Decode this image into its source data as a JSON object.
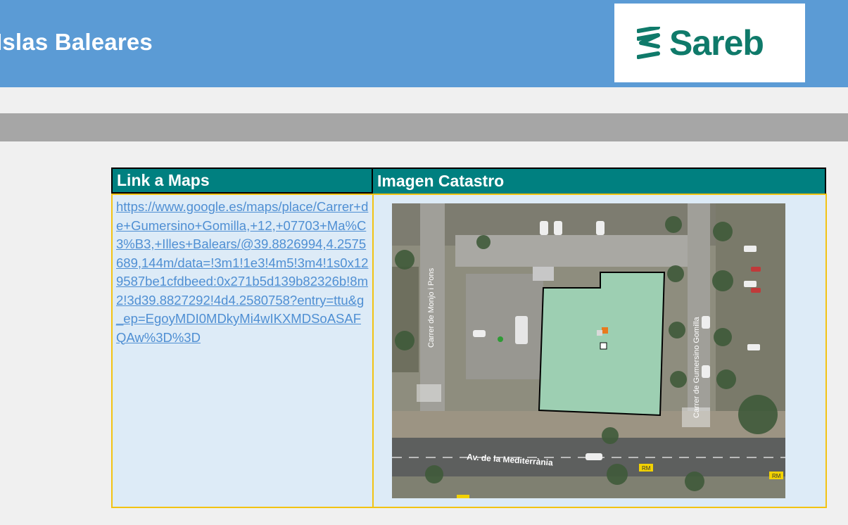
{
  "header": {
    "title": "Islas Baleares",
    "logo_text": "Sareb",
    "logo_color": "#0f7a6a",
    "background_color": "#5b9bd5"
  },
  "table": {
    "columns": [
      "Link a Maps",
      "Imagen Catastro"
    ],
    "header_color": "#008080",
    "border_color": "#f2c313",
    "maps_link": "https://www.google.es/maps/place/Carrer+de+Gumersino+Gomilla,+12,+07703+Ma%C3%B3,+Illes+Balears/@39.8826994,4.2575689,144m/data=!3m1!1e3!4m5!3m4!1s0x129587be1cfdbeed:0x271b5d139b82326b!8m2!3d39.8827292!4d4.2580758?entry=ttu&g_ep=EgoyMDI0MDkyMi4wIKXMDSoASAFQAw%3D%3D"
  },
  "map": {
    "street_left": "Carrer de Monjo i Pons",
    "street_right": "Carrer de Gumersino Gomilla",
    "avenue": "Av. de la Mediterrània",
    "road_sign_1": "RM",
    "road_sign_2": "RM",
    "parcel_color": "#9dcfb2",
    "parcel_outline_color": "#000000"
  }
}
